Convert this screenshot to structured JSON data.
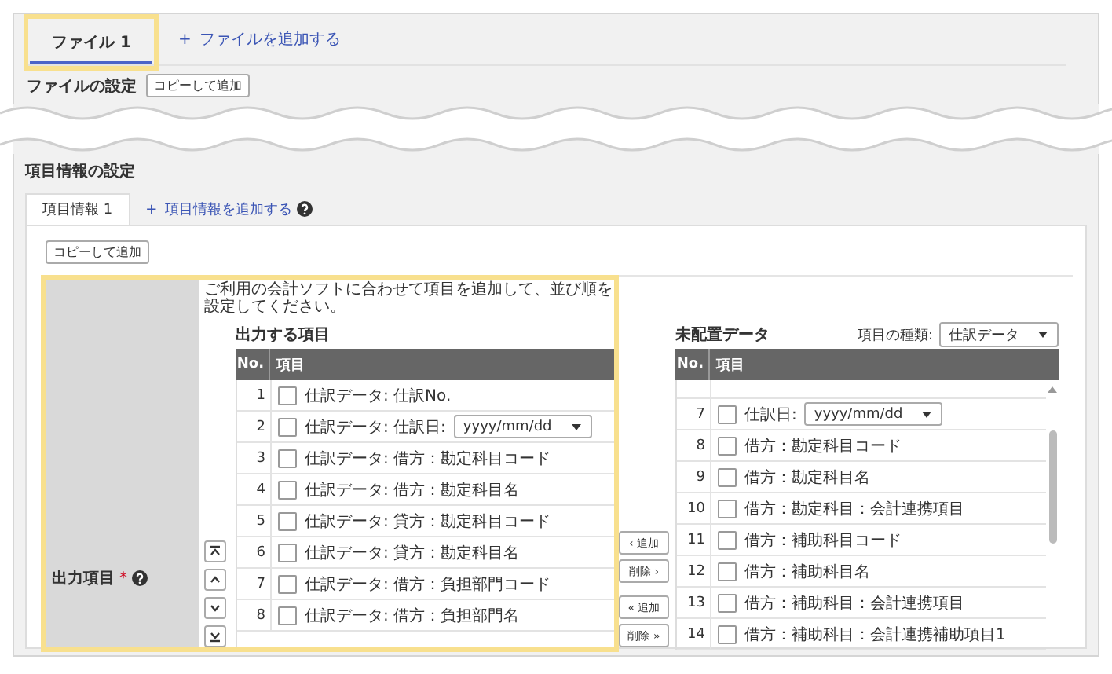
{
  "file_tabs": [
    {
      "label": "ファイル 1",
      "selected": true
    }
  ],
  "add_file_link": {
    "icon": "+",
    "label": "ファイルを追加する"
  },
  "file_settings": {
    "title": "ファイルの設定",
    "copy_button": "コピーして追加"
  },
  "item_settings": {
    "title": "項目情報の設定",
    "tabs": [
      {
        "label": "項目情報 1",
        "selected": true
      }
    ],
    "add_link": {
      "icon": "+",
      "label": "項目情報を追加する"
    },
    "copy_button": "コピーして追加"
  },
  "output_field": {
    "label": "出力項目",
    "required_mark": "*",
    "description": "ご利用の会計ソフトに合わせて項目を追加して、並び順を設定してください。",
    "output_list": {
      "title": "出力する項目",
      "columns": [
        "No.",
        "項目"
      ],
      "rows": [
        {
          "no": "1",
          "kind": "text",
          "label": "仕訳データ: 仕訳No.",
          "checked": false
        },
        {
          "no": "2",
          "kind": "date",
          "label": "仕訳データ: 仕訳日:",
          "select": "yyyy/mm/dd",
          "checked": false
        },
        {
          "no": "3",
          "kind": "text",
          "label": "仕訳データ: 借方：勘定科目コード",
          "checked": false
        },
        {
          "no": "4",
          "kind": "text",
          "label": "仕訳データ: 借方：勘定科目名",
          "checked": false
        },
        {
          "no": "5",
          "kind": "text",
          "label": "仕訳データ: 貸方：勘定科目コード",
          "checked": false
        },
        {
          "no": "6",
          "kind": "text",
          "label": "仕訳データ: 貸方：勘定科目名",
          "checked": false
        },
        {
          "no": "7",
          "kind": "text",
          "label": "仕訳データ: 借方：負担部門コード",
          "checked": false
        },
        {
          "no": "8",
          "kind": "text",
          "label": "仕訳データ: 借方：負担部門名",
          "checked": false
        }
      ]
    },
    "transfer_buttons": [
      "‹ 追加",
      "削除 ›",
      "« 追加",
      "削除 »"
    ],
    "unplaced_list": {
      "title": "未配置データ",
      "type_label": "項目の種類:",
      "type_value": "仕訳データ",
      "columns": [
        "No.",
        "項目"
      ],
      "rows": [
        {
          "no": "7",
          "kind": "date",
          "label": "仕訳日:",
          "select": "yyyy/mm/dd",
          "checked": false
        },
        {
          "no": "8",
          "kind": "text",
          "label": "借方：勘定科目コード",
          "checked": false
        },
        {
          "no": "9",
          "kind": "text",
          "label": "借方：勘定科目名",
          "checked": false
        },
        {
          "no": "10",
          "kind": "text",
          "label": "借方：勘定科目：会計連携項目",
          "checked": false
        },
        {
          "no": "11",
          "kind": "text",
          "label": "借方：補助科目コード",
          "checked": false
        },
        {
          "no": "12",
          "kind": "text",
          "label": "借方：補助科目名",
          "checked": false
        },
        {
          "no": "13",
          "kind": "text",
          "label": "借方：補助科目：会計連携項目",
          "checked": false
        },
        {
          "no": "14",
          "kind": "text",
          "label": "借方：補助科目：会計連携補助項目1",
          "checked": false
        }
      ]
    }
  }
}
